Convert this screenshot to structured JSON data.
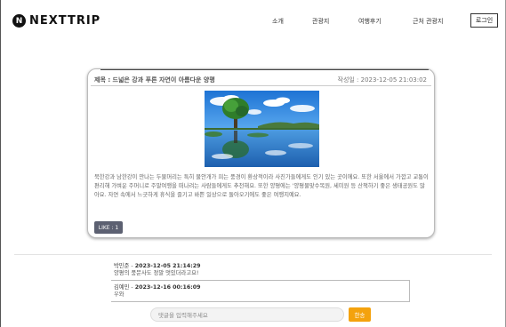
{
  "header": {
    "logo_letter": "N",
    "logo_text": "NEXTTRIP",
    "nav": [
      "소개",
      "관광지",
      "여행후기",
      "근처 관광지"
    ],
    "login_label": "로그인"
  },
  "post": {
    "title": "제목 : 드넓은 강과 푸른 자연이 아름다운 양평",
    "date": "작성일 : 2023-12-05 21:03:02",
    "body": "북한강과 남한강이 만나는 두물머리는 특히 물안개가 피는 풍경이 환상적이라 사진가들에게도 인기 있는 곳이에요. 또한 서울에서 가깝고 교통이 편리해 가벼운 주머니로 주말여행을 떠나려는 사람들에게도 추천해요. 또한 양평에는 '양평물맞수목원, 세미원 등 산책하기 좋은 생태공원도 많아요. 자연 속에서 느긋하게 휴식을 즐기고 바쁜 일상으로 돌아오기에도 좋은 여행지예요.",
    "like_label": "LIKE : 1"
  },
  "comments": [
    {
      "author": "박민준",
      "date": "2023-12-05 21:14:29",
      "text": "양평의 풍문사도 정말 멋있더라고요!"
    },
    {
      "author": "김예민",
      "date": "2023-12-16 00:16:09",
      "text": "우와"
    }
  ],
  "comment_form": {
    "placeholder": "댓글을 입력해주세요",
    "submit_label": "한송"
  },
  "colors": {
    "like_button": "#5c6071",
    "submit_button": "#f4a20d"
  }
}
